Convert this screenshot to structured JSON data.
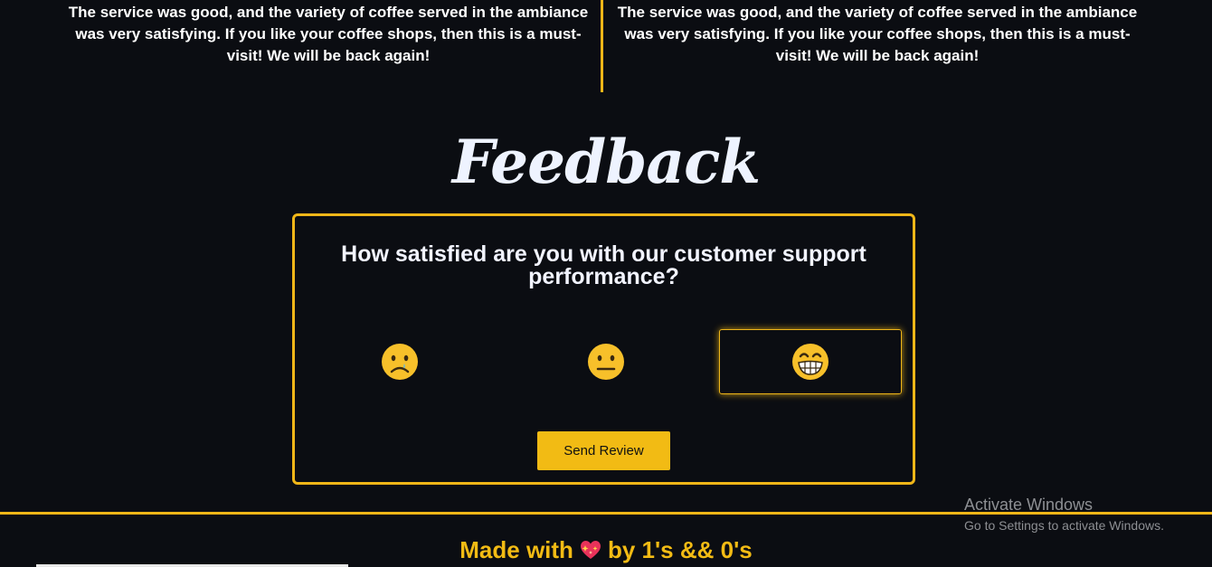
{
  "testimonials": [
    {
      "text": "The service was good, and the variety of coffee served in the ambiance was very satisfying. If you like your coffee shops, then this is a must-visit! We will be back again!"
    },
    {
      "text": "The service was good, and the variety of coffee served in the ambiance was very satisfying. If you like your coffee shops, then this is a must-visit! We will be back again!"
    }
  ],
  "feedback": {
    "title": "Feedback",
    "question": "How satisfied are you with our customer support performance?",
    "ratings": [
      {
        "icon": "sad-face-icon",
        "selected": false
      },
      {
        "icon": "neutral-face-icon",
        "selected": false
      },
      {
        "icon": "grinning-face-icon",
        "selected": true
      }
    ],
    "send_label": "Send Review"
  },
  "footer": {
    "made_with": "Made with",
    "heart_icon": "sparkling-heart-icon",
    "by": "by 1's && 0's"
  },
  "activation": {
    "title": "Activate Windows",
    "subtitle": "Go to Settings to activate Windows."
  },
  "colors": {
    "background": "#0b0d12",
    "accent": "#f0b618",
    "button": "#f2bb14",
    "emoji": "#f7c02a"
  }
}
